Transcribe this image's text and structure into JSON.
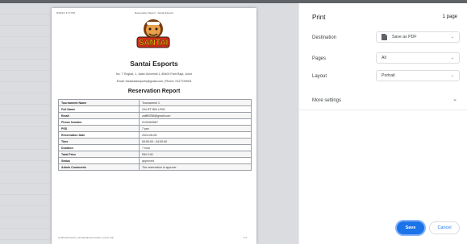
{
  "colors": {
    "accent": "#1a73e8",
    "preview_bg": "#dadce0",
    "panel_bg": "#ffffff"
  },
  "preview": {
    "header_left": "8/16/24, 6:17 PM",
    "header_center": "Reservation Report - Santai Esports",
    "logo_text": "SANTAI",
    "brand": "Santai Esports",
    "address": "No. 7 Tingkat, 1, Jalan Universiti 1, 85400 Parit Raja, Johor",
    "contact": "Email: thesantaiesports@gmail.com | Phone: 0127729004",
    "report_title": "Reservation Report",
    "rows": [
      {
        "label": "Tournament Name",
        "value": "Tournament 1"
      },
      {
        "label": "Full Name",
        "value": "ZALIFF BIN USIN"
      },
      {
        "label": "Email",
        "value": "zaliff0258@gmail.com"
      },
      {
        "label": "Phone Number",
        "value": "0133463667"
      },
      {
        "label": "PSS",
        "value": "7 pss"
      },
      {
        "label": "Reservation Date",
        "value": "2024-06-06"
      },
      {
        "label": "Time",
        "value": "09:00:00 - 04:00:00"
      },
      {
        "label": "Duration",
        "value": "7 hour"
      },
      {
        "label": "Total Price",
        "value": "RM 3.00"
      },
      {
        "label": "Status",
        "value": "approved"
      },
      {
        "label": "Admin Comments",
        "value": "The reservation is approve"
      }
    ],
    "footer_left": "localhost/esports_santai/php/reservation_report.php",
    "footer_right": "1/1"
  },
  "panel": {
    "title": "Print",
    "page_count": "1 page",
    "destination_label": "Destination",
    "destination_value": "Save as PDF",
    "destination_icon": "document-icon",
    "pages_label": "Pages",
    "pages_value": "All",
    "layout_label": "Layout",
    "layout_value": "Portrait",
    "more_settings": "More settings",
    "save": "Save",
    "cancel": "Cancel"
  }
}
